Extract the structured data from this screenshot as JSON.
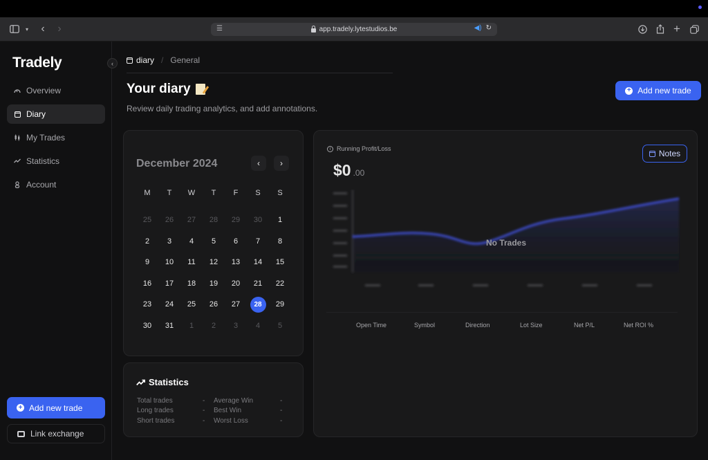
{
  "browser": {
    "url": "app.tradely.lytestudios.be"
  },
  "sidebar": {
    "logo": "Tradely",
    "items": [
      {
        "label": "Overview",
        "icon": "gauge-icon"
      },
      {
        "label": "Diary",
        "icon": "calendar-icon",
        "active": true
      },
      {
        "label": "My Trades",
        "icon": "candles-icon"
      },
      {
        "label": "Statistics",
        "icon": "trend-icon"
      },
      {
        "label": "Account",
        "icon": "user-icon"
      }
    ],
    "add_trade_label": "Add new trade",
    "link_exchange_label": "Link exchange"
  },
  "breadcrumb": {
    "current": "diary",
    "next": "General"
  },
  "header": {
    "title": "Your diary",
    "subtitle": "Review daily trading analytics, and add annotations.",
    "add_trade_label": "Add new trade"
  },
  "calendar": {
    "month_label": "December 2024",
    "weekdays": [
      "M",
      "T",
      "W",
      "T",
      "F",
      "S",
      "S"
    ],
    "weeks": [
      [
        {
          "d": "25",
          "m": true
        },
        {
          "d": "26",
          "m": true
        },
        {
          "d": "27",
          "m": true
        },
        {
          "d": "28",
          "m": true
        },
        {
          "d": "29",
          "m": true
        },
        {
          "d": "30",
          "m": true
        },
        {
          "d": "1"
        }
      ],
      [
        {
          "d": "2"
        },
        {
          "d": "3"
        },
        {
          "d": "4"
        },
        {
          "d": "5"
        },
        {
          "d": "6"
        },
        {
          "d": "7"
        },
        {
          "d": "8"
        }
      ],
      [
        {
          "d": "9"
        },
        {
          "d": "10"
        },
        {
          "d": "11"
        },
        {
          "d": "12"
        },
        {
          "d": "13"
        },
        {
          "d": "14"
        },
        {
          "d": "15"
        }
      ],
      [
        {
          "d": "16"
        },
        {
          "d": "17"
        },
        {
          "d": "18"
        },
        {
          "d": "19"
        },
        {
          "d": "20"
        },
        {
          "d": "21"
        },
        {
          "d": "22"
        }
      ],
      [
        {
          "d": "23"
        },
        {
          "d": "24"
        },
        {
          "d": "25"
        },
        {
          "d": "26"
        },
        {
          "d": "27"
        },
        {
          "d": "28",
          "sel": true
        },
        {
          "d": "29"
        }
      ],
      [
        {
          "d": "30"
        },
        {
          "d": "31"
        },
        {
          "d": "1",
          "m": true
        },
        {
          "d": "2",
          "m": true
        },
        {
          "d": "3",
          "m": true
        },
        {
          "d": "4",
          "m": true
        },
        {
          "d": "5",
          "m": true
        }
      ]
    ]
  },
  "statistics": {
    "title": "Statistics",
    "rows": [
      {
        "k1": "Total trades",
        "v1": "-",
        "k2": "Average Win",
        "v2": "-"
      },
      {
        "k1": "Long trades",
        "v1": "-",
        "k2": "Best Win",
        "v2": "-"
      },
      {
        "k1": "Short trades",
        "v1": "-",
        "k2": "Worst Loss",
        "v2": "-"
      }
    ]
  },
  "pnl": {
    "label": "Running Profit/Loss",
    "value": "$0",
    "cents": ".00",
    "notes_label": "Notes",
    "empty_label": "No Trades",
    "columns": [
      "Open Time",
      "Symbol",
      "Direction",
      "Lot Size",
      "Net P/L",
      "Net ROI %"
    ]
  },
  "colors": {
    "accent": "#3a63f0",
    "background": "#111112",
    "card": "#19191a"
  }
}
